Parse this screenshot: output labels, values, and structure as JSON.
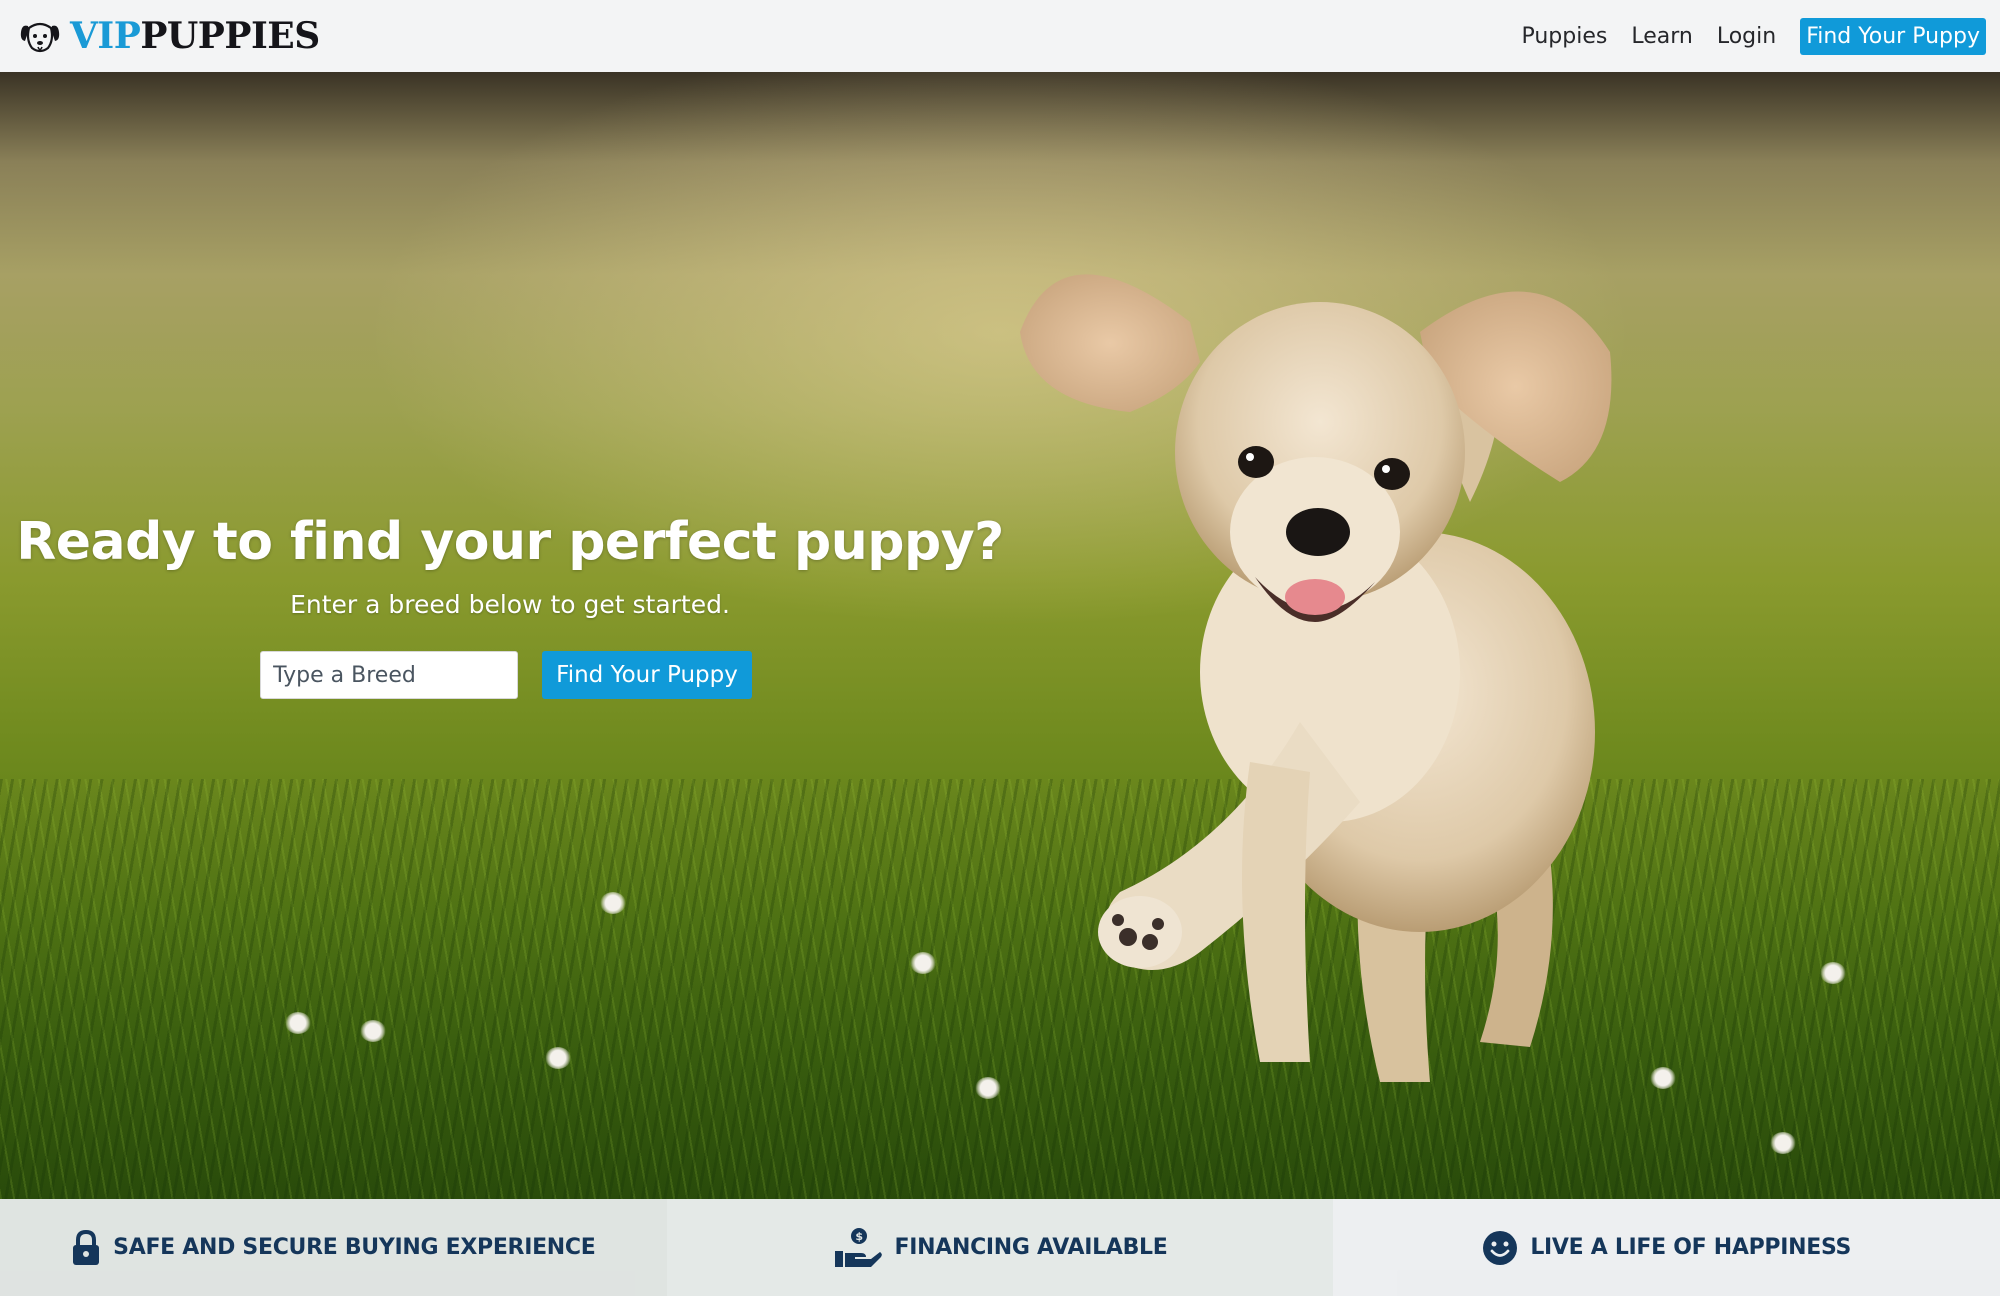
{
  "brand": {
    "logo_icon": "dog-face-icon",
    "name_part1": "VIP",
    "name_part2": "PUPPIES",
    "accent_color": "#1a9ad6"
  },
  "nav": {
    "items": [
      {
        "label": "Puppies"
      },
      {
        "label": "Learn"
      },
      {
        "label": "Login"
      }
    ],
    "cta_label": "Find Your Puppy",
    "cta_color": "#109ad9"
  },
  "hero": {
    "title": "Ready to find your perfect puppy?",
    "subtitle": "Enter a breed below to get started.",
    "search_placeholder": "Type a Breed",
    "search_value": "",
    "button_label": "Find Your Puppy"
  },
  "features": [
    {
      "icon": "lock-icon",
      "label": "SAFE AND SECURE BUYING EXPERIENCE"
    },
    {
      "icon": "hand-money-icon",
      "label": "FINANCING AVAILABLE"
    },
    {
      "icon": "smiley-icon",
      "label": "LIVE A LIFE OF HAPPINESS"
    }
  ],
  "colors": {
    "feature_text": "#15365a",
    "nav_background": "#f3f4f5"
  }
}
